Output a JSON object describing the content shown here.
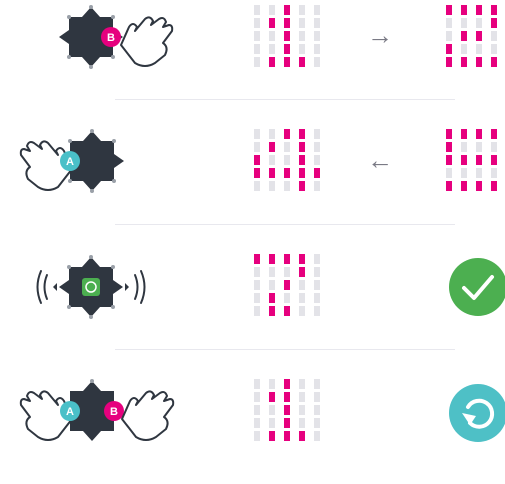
{
  "colors": {
    "pink": "#e6007e",
    "grid_off": "#e3e3e8",
    "device": "#2f3640",
    "btn_a": "#4ac0c8",
    "btn_b": "#e6007e",
    "success": "#4caf50",
    "reset": "#4ec0c6",
    "arrow": "#7a7a85"
  },
  "rows": [
    {
      "device_label": "B",
      "left_grid": [
        [
          0,
          0,
          1,
          0,
          0
        ],
        [
          0,
          1,
          1,
          0,
          0
        ],
        [
          0,
          0,
          1,
          0,
          0
        ],
        [
          0,
          0,
          1,
          0,
          0
        ],
        [
          0,
          1,
          1,
          1,
          0
        ]
      ],
      "arrow": "→",
      "right_grid": [
        [
          1,
          1,
          1,
          1,
          0
        ],
        [
          0,
          0,
          0,
          1,
          0
        ],
        [
          0,
          1,
          1,
          0,
          0
        ],
        [
          1,
          0,
          0,
          0,
          0
        ],
        [
          1,
          1,
          1,
          1,
          0
        ]
      ]
    },
    {
      "device_label": "A",
      "left_grid": [
        [
          0,
          0,
          1,
          1,
          0
        ],
        [
          0,
          1,
          0,
          1,
          0
        ],
        [
          1,
          0,
          0,
          1,
          0
        ],
        [
          1,
          1,
          1,
          1,
          1
        ],
        [
          0,
          0,
          0,
          1,
          0
        ]
      ],
      "arrow": "←",
      "right_grid": [
        [
          1,
          1,
          1,
          1,
          1
        ],
        [
          1,
          0,
          0,
          0,
          0
        ],
        [
          1,
          1,
          1,
          1,
          0
        ],
        [
          0,
          0,
          0,
          0,
          1
        ],
        [
          1,
          1,
          1,
          1,
          0
        ]
      ]
    },
    {
      "device_label": "",
      "left_grid": [
        [
          1,
          1,
          1,
          1,
          0
        ],
        [
          0,
          0,
          0,
          1,
          0
        ],
        [
          0,
          0,
          1,
          0,
          0
        ],
        [
          0,
          1,
          0,
          0,
          0
        ],
        [
          0,
          1,
          1,
          0,
          0
        ]
      ],
      "status_icon": "check-icon"
    },
    {
      "device_label_a": "A",
      "device_label_b": "B",
      "left_grid": [
        [
          0,
          0,
          1,
          0,
          0
        ],
        [
          0,
          1,
          1,
          0,
          0
        ],
        [
          0,
          0,
          1,
          0,
          0
        ],
        [
          0,
          0,
          1,
          0,
          0
        ],
        [
          0,
          1,
          1,
          1,
          0
        ]
      ],
      "status_icon": "reset-icon"
    }
  ]
}
